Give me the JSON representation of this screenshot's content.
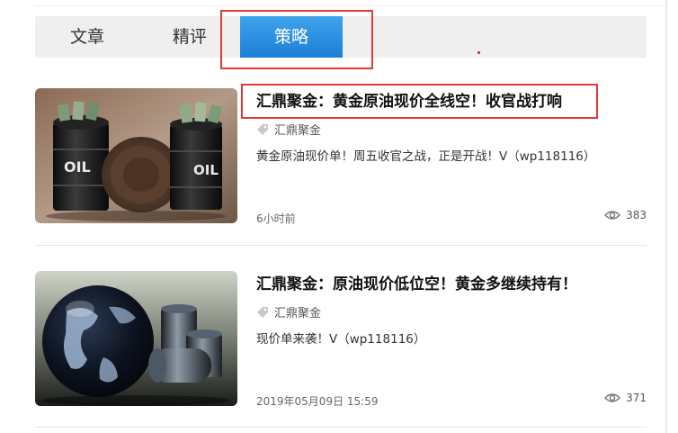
{
  "tabs": [
    {
      "label": "文章"
    },
    {
      "label": "精评"
    },
    {
      "label": "策略"
    }
  ],
  "articles": [
    {
      "title": "汇鼎聚金：黄金原油现价全线空！收官战打响",
      "tag": "汇鼎聚金",
      "summary": "黄金原油现价单！周五收官之战，正是开战！V（wp118116）",
      "time": "6小时前",
      "views": "383",
      "image": "oil-barrels-with-money-icon",
      "image_text": [
        "OIL",
        "OIL"
      ]
    },
    {
      "title": "汇鼎聚金：原油现价低位空！黄金多继续持有！",
      "tag": "汇鼎聚金",
      "summary": "现价单来袭！V（wp118116）",
      "time": "2019年05月09日 15:59",
      "views": "371",
      "image": "globe-with-oil-barrels-icon"
    }
  ],
  "colors": {
    "active_tab": "#1b7fd8",
    "highlight": "#e03b3b",
    "tab_bar": "#efefef"
  }
}
